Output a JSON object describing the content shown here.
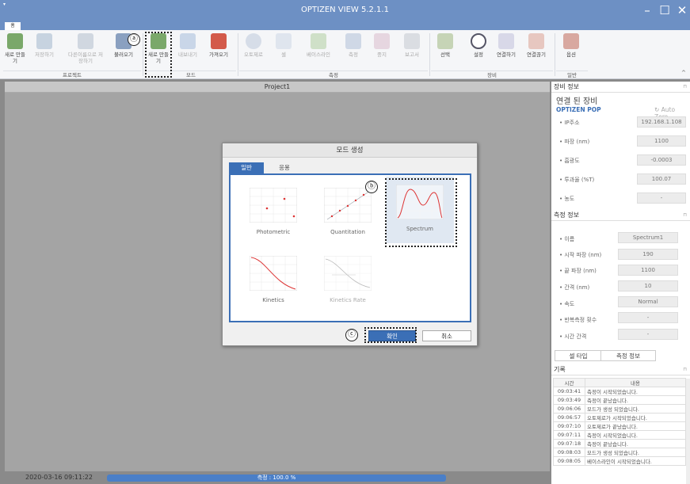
{
  "window": {
    "title": "OPTIZEN VIEW 5.2.1.1",
    "home_tab": "홈"
  },
  "ribbon": {
    "groups": [
      {
        "label": "프로젝트",
        "buttons": [
          "새로 만들기",
          "저장하기",
          "다른이름으로 저장하기",
          "불러오기"
        ]
      },
      {
        "label": "모드",
        "buttons": [
          "새로 만들기",
          "내보내기",
          "가져오기"
        ]
      },
      {
        "label": "측정",
        "buttons": [
          "오토제로",
          "셀",
          "베이스라인",
          "측정",
          "중지",
          "보고서"
        ]
      },
      {
        "label": "장비",
        "buttons": [
          "선택",
          "설정",
          "연결하기",
          "연결끊기"
        ]
      },
      {
        "label": "일반",
        "buttons": [
          "옵션"
        ]
      }
    ],
    "badges": {
      "a": "ⓐ",
      "b": "ⓑ",
      "c": "ⓒ"
    }
  },
  "document": {
    "title": "Project1"
  },
  "status": {
    "date": "2020-03-16 09:11:22",
    "progress_text": "측정 : 100.0 %",
    "progress_percent": 100
  },
  "dialog": {
    "title": "모드 생성",
    "tabs": [
      "일반",
      "응용"
    ],
    "modes": [
      "Photometric",
      "Quantitation",
      "Spectrum",
      "Kinetics",
      "Kinetics Rate"
    ],
    "ok": "확인",
    "cancel": "취소"
  },
  "device_info": {
    "header": "장비 정보",
    "connected": "연결 된 장비",
    "device_name": "OPTIZEN POP",
    "auto_zero": "Auto Zero",
    "rows": [
      {
        "label": "• IP주소",
        "value": "192.168.1.108"
      },
      {
        "label": "• 파장 (nm)",
        "value": "1100"
      },
      {
        "label": "• 흡광도",
        "value": "-0.0003"
      },
      {
        "label": "• 투과율 (%T)",
        "value": "100.07"
      },
      {
        "label": "• 농도",
        "value": "-"
      }
    ]
  },
  "measure_info": {
    "header": "측정 정보",
    "rows": [
      {
        "label": "• 이름",
        "value": "Spectrum1"
      },
      {
        "label": "• 시작 파장 (nm)",
        "value": "190"
      },
      {
        "label": "• 끝 파장 (nm)",
        "value": "1100"
      },
      {
        "label": "• 간격 (nm)",
        "value": "10"
      },
      {
        "label": "• 속도",
        "value": "Normal"
      },
      {
        "label": "• 반복측정 횟수",
        "value": "-"
      },
      {
        "label": "• 시간 간격",
        "value": "-"
      }
    ],
    "tabs": [
      "셀 타입",
      "측정 정보"
    ]
  },
  "log": {
    "header": "기록",
    "columns": [
      "시간",
      "내용"
    ],
    "rows": [
      [
        "09:03:41",
        "측정이 시작되었습니다."
      ],
      [
        "09:03:49",
        "측정이 끝났습니다."
      ],
      [
        "09:06:06",
        "모드가 생성 되었습니다."
      ],
      [
        "09:06:57",
        "오토제로가 시작되었습니다."
      ],
      [
        "09:07:10",
        "오토제로가 끝났습니다."
      ],
      [
        "09:07:11",
        "측정이 시작되었습니다."
      ],
      [
        "09:07:18",
        "측정이 끝났습니다."
      ],
      [
        "09:08:03",
        "모드가 생성 되었습니다."
      ],
      [
        "09:08:05",
        "베이스라인이 시작되었습니다."
      ]
    ]
  },
  "colors": {
    "title_bar": "#6d90c4",
    "accent": "#3b6fb6",
    "work_area": "#a4a4a4"
  }
}
